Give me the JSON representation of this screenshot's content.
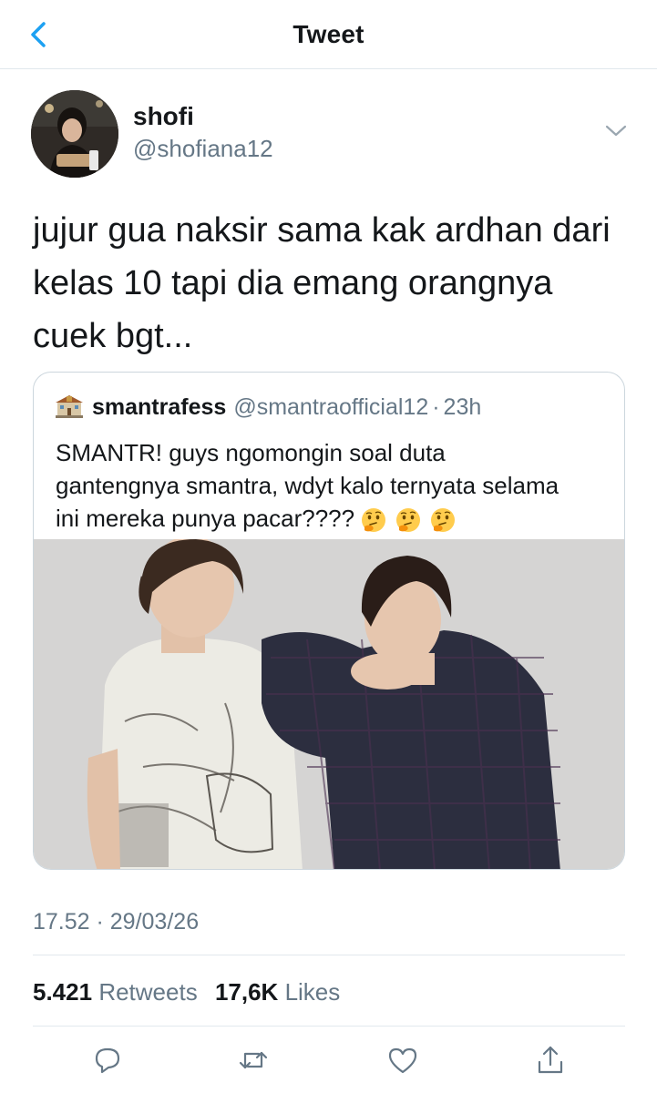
{
  "header": {
    "title": "Tweet"
  },
  "colors": {
    "accent": "#1da1f2",
    "text": "#14171a",
    "secondary": "#657786",
    "border": "#e1e8ed"
  },
  "author": {
    "name": "shofi",
    "handle": "@shofiana12"
  },
  "tweet": {
    "lines": [
      "jujur gua naksir sama kak ardhan dari",
      "kelas 10 tapi dia emang orangnya",
      "cuek bgt..."
    ]
  },
  "quote": {
    "icon": "school-building-icon",
    "name": "smantrafess",
    "handle": "@smantraofficial12",
    "separator": "·",
    "time": "23h",
    "lines": [
      "SMANTR! guys ngomongin soal duta",
      "gantengnya smantra, wdyt kalo ternyata selama",
      "ini mereka punya pacar????"
    ],
    "emojis": [
      "thinking-face-icon",
      "thinking-face-icon",
      "thinking-face-icon"
    ]
  },
  "timestamp": "17.52 · 29/03/26",
  "stats": {
    "retweets_count": "5.421",
    "retweets_label": "Retweets",
    "likes_count": "17,6K",
    "likes_label": "Likes"
  },
  "actions": [
    "reply-icon",
    "retweet-icon",
    "like-icon",
    "share-icon"
  ]
}
